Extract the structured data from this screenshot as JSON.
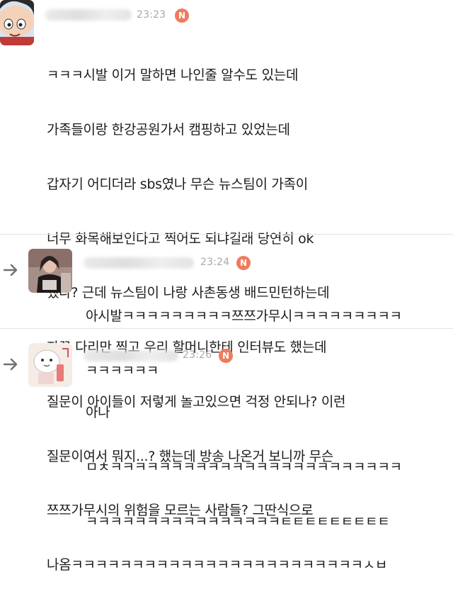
{
  "comments": [
    {
      "time": "23:23",
      "badge": "N",
      "lines": [
        "ㅋㅋㅋ시발 이거 말하면 나인줄 알수도 있는데",
        "가족들이랑 한강공원가서 캠핑하고 있었는데",
        "갑자기 어디더라 sbs였나 무슨 뉴스팀이 가족이",
        "너무 화목해보인다고 찍어도 되냐길래 당연히 ok",
        "했다? 근데 뉴스팀이 나랑 사촌동생 배드민턴하는데",
        "자꾸 다리만 찍고 우리 할머니한테 인터뷰도 했는데",
        "질문이 아이들이 저렇게 놀고있으면 걱정 안되나? 이런",
        "질문이여서 뭐지...? 했는데 방송 나온거 보니까 무슨",
        "쯔쯔가무시의 위험을 모르는 사람들? 그딴식으로",
        "나옴ㅋㅋㅋㅋㅋㅋㅋㅋㅋㅋㅋㅋㅋㅋㅋㅋㅋㅋㅋㅋㅋㅋㅋㅋㅅㅂ"
      ]
    },
    {
      "time": "23:24",
      "badge": "N",
      "lines": [
        "아시발ㅋㅋㅋㅋㅋㅋㅋㅋㅋ쯔쯔가무시ㅋㅋㅋㅋㅋㅋㅋㅋㅋ",
        "ㅋㅋㅋㅋㅋㅋ"
      ]
    },
    {
      "time": "23:26",
      "badge": "N",
      "lines": [
        "아나",
        "ㅁㅊㅋㅋㅋㅋㅋㅋㅋㅋㅋㅋㅋㅋㅋㅋㅋㅋㅋㅋㅋㅋㅋㅋㅋㅋ",
        "ㅋㅋㅋㅋㅋㅋㅋㅋㅋㅋㅋㅋㅋㅋㅋㅋㅌㅌㅌㅌㅌㅌㅌㅌㅌ"
      ]
    }
  ],
  "colors": {
    "badge": "#ef7b5e",
    "time": "#a9a9a9",
    "divider": "#e3e3e3",
    "reply_arrow": "#6f6f6f"
  },
  "icons": {
    "reply": "reply-arrow-icon",
    "badge": "new-badge-icon"
  }
}
